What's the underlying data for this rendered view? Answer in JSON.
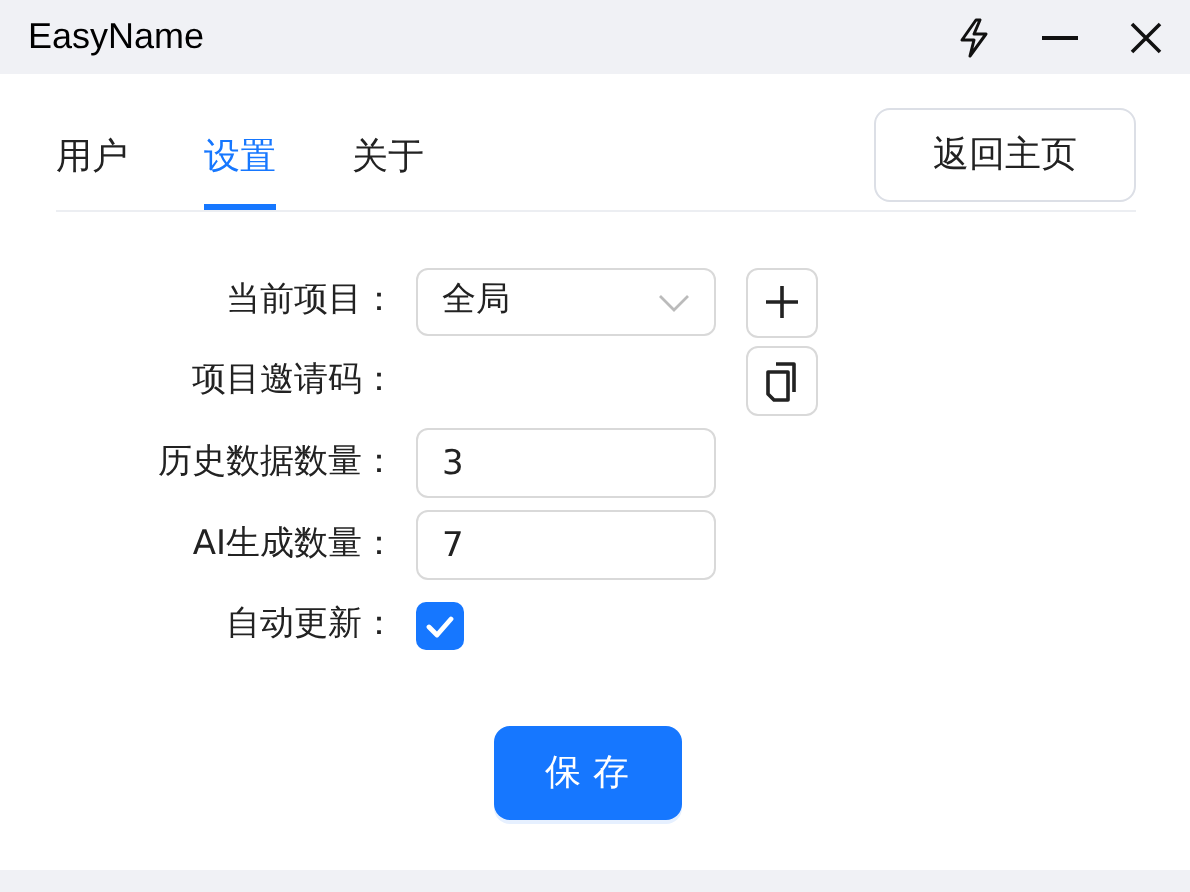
{
  "window": {
    "title": "EasyName"
  },
  "tabs": [
    {
      "label": "用户",
      "selected": false
    },
    {
      "label": "设置",
      "selected": true
    },
    {
      "label": "关于",
      "selected": false
    }
  ],
  "home_button": "返回主页",
  "form": [
    {
      "kind": "select",
      "label": "当前项目：",
      "value": "全局"
    },
    {
      "kind": "copy",
      "label": "项目邀请码："
    },
    {
      "kind": "input",
      "label": "历史数据数量：",
      "value": "3"
    },
    {
      "kind": "input",
      "label": "AI生成数量：",
      "value": "7"
    },
    {
      "kind": "checkbox",
      "label": "自动更新：",
      "checked": true
    }
  ],
  "save_button": "保 存"
}
